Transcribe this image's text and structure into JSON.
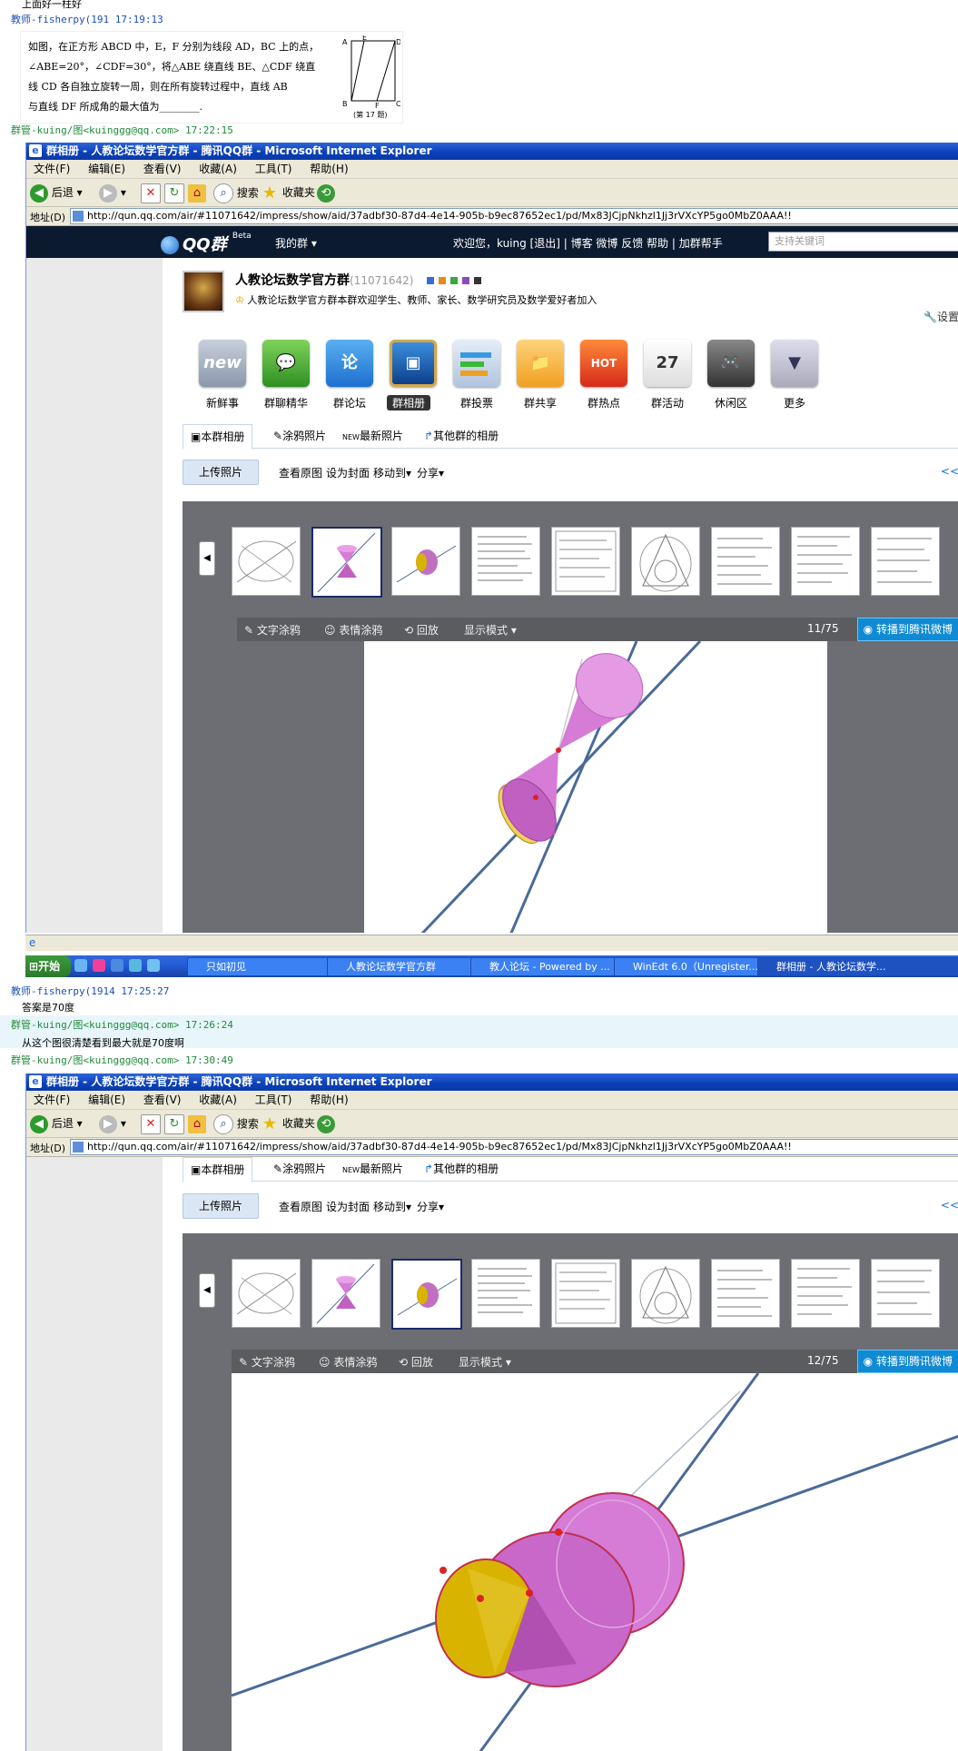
{
  "chat": {
    "line0_text": "上面好一柱好",
    "msg1_header": "教师-fisherpy(191      17:19:13",
    "problem": {
      "line1": "如图，在正方形 ABCD 中，E，F 分别为线段 AD，BC 上的点，",
      "line2": "∠ABE=20°，∠CDF=30°，将△ABE 绕直线 BE、△CDF 绕直",
      "line3": "线 CD 各自独立旋转一周，则在所有旋转过程中，直线 AB",
      "line4": "与直线 DF 所成角的最大值为________.",
      "caption": "(第 17 题)",
      "labels": [
        "A",
        "E",
        "D",
        "B",
        "F",
        "C"
      ]
    },
    "msg2_header": "群管-kuing/图<kuinggg@qq.com> 17:22:15",
    "msg3_header": "教师-fisherpy(1914      17:25:27",
    "msg3_text": "答案是70度",
    "msg4_header": "群管-kuing/图<kuinggg@qq.com> 17:26:24",
    "msg4_text": "从这个图很清楚看到最大就是70度啊",
    "msg5_header": "群管-kuing/图<kuinggg@qq.com> 17:30:49"
  },
  "ie": {
    "title": "群相册 - 人教论坛数学官方群 - 腾讯QQ群 - Microsoft Internet Explorer",
    "menu": [
      "文件(F)",
      "编辑(E)",
      "查看(V)",
      "收藏(A)",
      "工具(T)",
      "帮助(H)"
    ],
    "back": "后退",
    "search": "搜索",
    "favorites": "收藏夹",
    "address_label": "地址(D)",
    "url": "http://qun.qq.com/air/#11071642/impress/show/aid/37adbf30-87d4-4e14-905b-b9ec87652ec1/pd/Mx83JCjpNkhzl1Jj3rVXcYP5go0MbZ0AAA!!"
  },
  "qq": {
    "logo": "QQ群",
    "beta": "Beta",
    "my_groups": "我的群 ▾",
    "welcome": "欢迎您，kuing  [退出]  | 博客 微博 反馈 帮助  | 加群帮手",
    "search_placeholder": "支持关键词",
    "group_name": "人教论坛数学官方群",
    "group_num": "(11071642)",
    "group_desc": "人教论坛数学官方群本群欢迎学生、教师、家长、数学研究员及数学爱好者加入",
    "settings": "设置",
    "apps": [
      "新鲜事",
      "群聊精华",
      "群论坛",
      "群相册",
      "群投票",
      "群共享",
      "群热点",
      "群活动",
      "休闲区",
      "更多"
    ],
    "app_icon_text": [
      "new",
      "",
      "论",
      "",
      "",
      "",
      "HOT",
      "27",
      "",
      ""
    ],
    "tabs": [
      "本群相册",
      "涂鸦照片",
      "最新照片",
      "其他群的相册"
    ],
    "upload": "上传照片",
    "actions": [
      "查看原图",
      "设为封面",
      "移动到▾",
      "分享▾"
    ],
    "paging": "<<",
    "viewer_tools": [
      "文字涂鸦",
      "表情涂鸦",
      "回放",
      "显示模式 ▾"
    ],
    "counter1": "11/75",
    "counter2": "12/75",
    "share_weibo": "转播到腾讯微博"
  },
  "taskbar": {
    "start": "开始",
    "tasks": [
      "只如初见",
      "人教论坛数学官方群",
      "教人论坛 - Powered by ...",
      "WinEdt 6.0（Unregister...",
      "群相册 - 人教论坛数学..."
    ]
  },
  "colors": {
    "cone_magenta": "#d67bd6",
    "cone_gold": "#d8b400",
    "line_blue": "#4a6a9a",
    "title_blue": "#0a3fb7"
  }
}
